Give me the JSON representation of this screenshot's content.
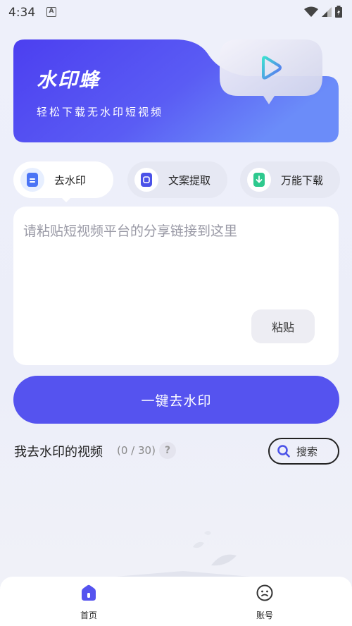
{
  "status_bar": {
    "time": "4:34",
    "app_icon_letter": "A"
  },
  "banner": {
    "title": "水印蜂",
    "subtitle": "轻松下载无水印短视频",
    "play_icon": "play-icon"
  },
  "tabs": [
    {
      "label": "去水印",
      "icon": "document-icon",
      "active": true
    },
    {
      "label": "文案提取",
      "icon": "text-scan-icon",
      "active": false
    },
    {
      "label": "万能下载",
      "icon": "download-icon",
      "active": false
    }
  ],
  "input": {
    "placeholder": "请粘贴短视频平台的分享链接到这里",
    "value": "",
    "paste_label": "粘贴"
  },
  "action": {
    "label": "一键去水印"
  },
  "list": {
    "title": "我去水印的视频",
    "count": "(0 / 30)",
    "help_symbol": "?",
    "search_label": "搜索"
  },
  "bottom_nav": {
    "items": [
      {
        "label": "首页",
        "icon": "home-icon",
        "active": true
      },
      {
        "label": "账号",
        "icon": "account-icon",
        "active": false
      }
    ]
  },
  "colors": {
    "accent": "#5553ef",
    "banner_start": "#4c3ff0",
    "banner_end": "#6a8af8",
    "background": "#eef0fa"
  }
}
